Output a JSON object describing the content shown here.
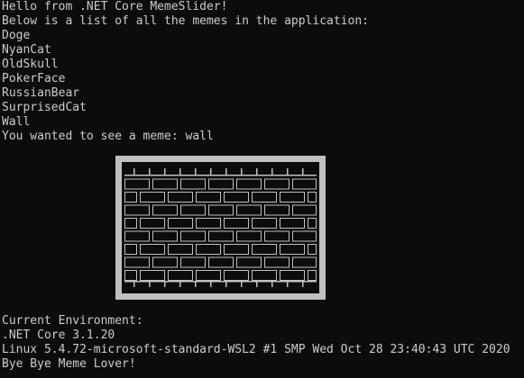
{
  "console": {
    "greeting": "Hello from .NET Core MemeSlider!",
    "list_intro": "Below is a list of all the memes in the application:",
    "memes": [
      "Doge",
      "NyanCat",
      "OldSkull",
      "PokerFace",
      "RussianBear",
      "SurprisedCat",
      "Wall"
    ],
    "selection": "You wanted to see a meme: wall",
    "env_header": "Current Environment:",
    "runtime": ".NET Core 3.1.20",
    "os": "Linux 5.4.72-microsoft-standard-WSL2 #1 SMP Wed Oct 28 23:40:43 UTC 2020",
    "farewell": "Bye Bye Meme Lover!"
  },
  "colors": {
    "background": "#0c0c0c",
    "text": "#cccccc",
    "art_light": "#c0c0c0"
  },
  "art": {
    "meme": "wall",
    "depiction": "brick-wall-ascii-art"
  }
}
